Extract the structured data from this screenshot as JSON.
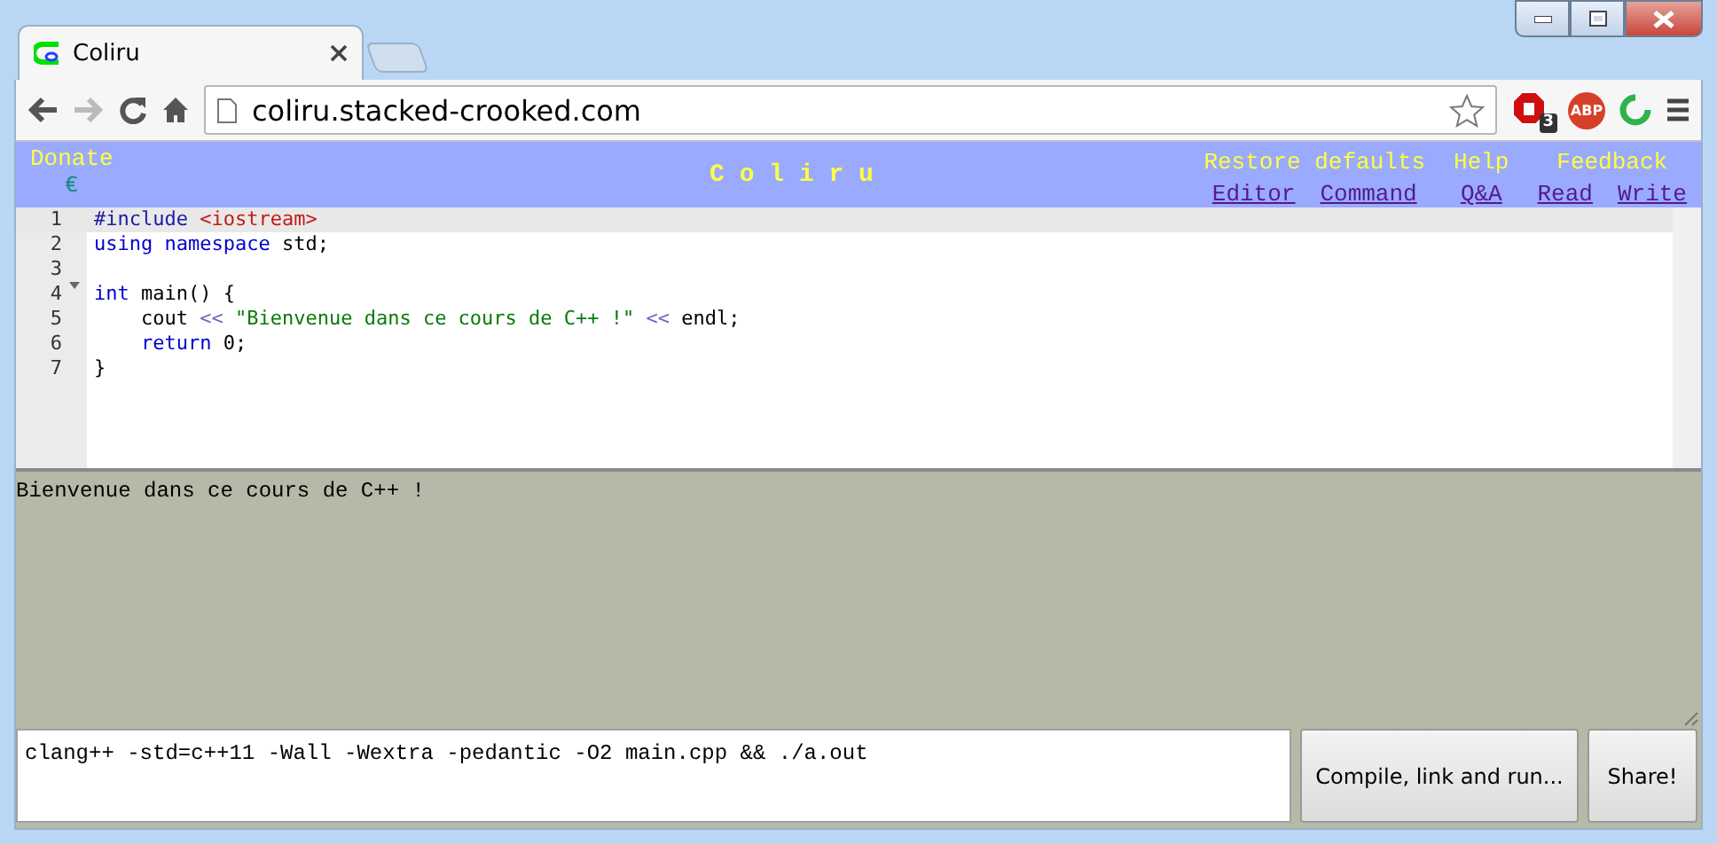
{
  "window": {
    "tab_title": "Coliru",
    "url": "coliru.stacked-crooked.com",
    "blocked_count": "3",
    "extension_label": "ABP"
  },
  "header": {
    "donate": "Donate",
    "currency": "€",
    "title": "C o l i r u",
    "groups": [
      {
        "title": "Restore defaults",
        "links": [
          "Editor",
          "Command"
        ]
      },
      {
        "title": "Help",
        "links": [
          "Q&A"
        ]
      },
      {
        "title": "Feedback",
        "links": [
          "Read",
          "Write"
        ]
      }
    ]
  },
  "editor": {
    "lines": [
      {
        "number": "1",
        "foldable": false,
        "current": true,
        "tokens": [
          {
            "kind": "meta",
            "text": "#include"
          },
          {
            "kind": "header",
            "text": " <iostream>"
          }
        ]
      },
      {
        "number": "2",
        "foldable": false,
        "current": false,
        "tokens": [
          {
            "kind": "keyword",
            "text": "using namespace"
          },
          {
            "kind": "plain",
            "text": " std;"
          }
        ]
      },
      {
        "number": "3",
        "foldable": false,
        "current": false
      },
      {
        "number": "4",
        "foldable": true,
        "current": false,
        "tokens": [
          {
            "kind": "keyword",
            "text": "int"
          },
          {
            "kind": "plain",
            "text": " main() {"
          }
        ]
      },
      {
        "number": "5",
        "foldable": false,
        "current": false,
        "tokens": [
          {
            "kind": "plain",
            "text": "    cout "
          },
          {
            "kind": "operator",
            "text": "<<"
          },
          {
            "kind": "string",
            "text": " \"Bienvenue dans ce cours de C++ !\""
          },
          {
            "kind": "operator",
            "text": " <<"
          },
          {
            "kind": "plain",
            "text": " endl;"
          }
        ]
      },
      {
        "number": "6",
        "foldable": false,
        "current": false,
        "tokens": [
          {
            "kind": "keyword",
            "text": "    return"
          },
          {
            "kind": "number",
            "text": " 0"
          },
          {
            "kind": "plain",
            "text": ";"
          }
        ]
      },
      {
        "number": "7",
        "foldable": false,
        "current": false,
        "tokens": [
          {
            "kind": "plain",
            "text": "}"
          }
        ]
      }
    ]
  },
  "output": {
    "text": "Bienvenue dans ce cours de C++ !"
  },
  "command": {
    "value": "clang++ -std=c++11 -Wall -Wextra -pedantic -O2 main.cpp && ./a.out"
  },
  "buttons": [
    "Compile, link and run...",
    "Share!"
  ]
}
